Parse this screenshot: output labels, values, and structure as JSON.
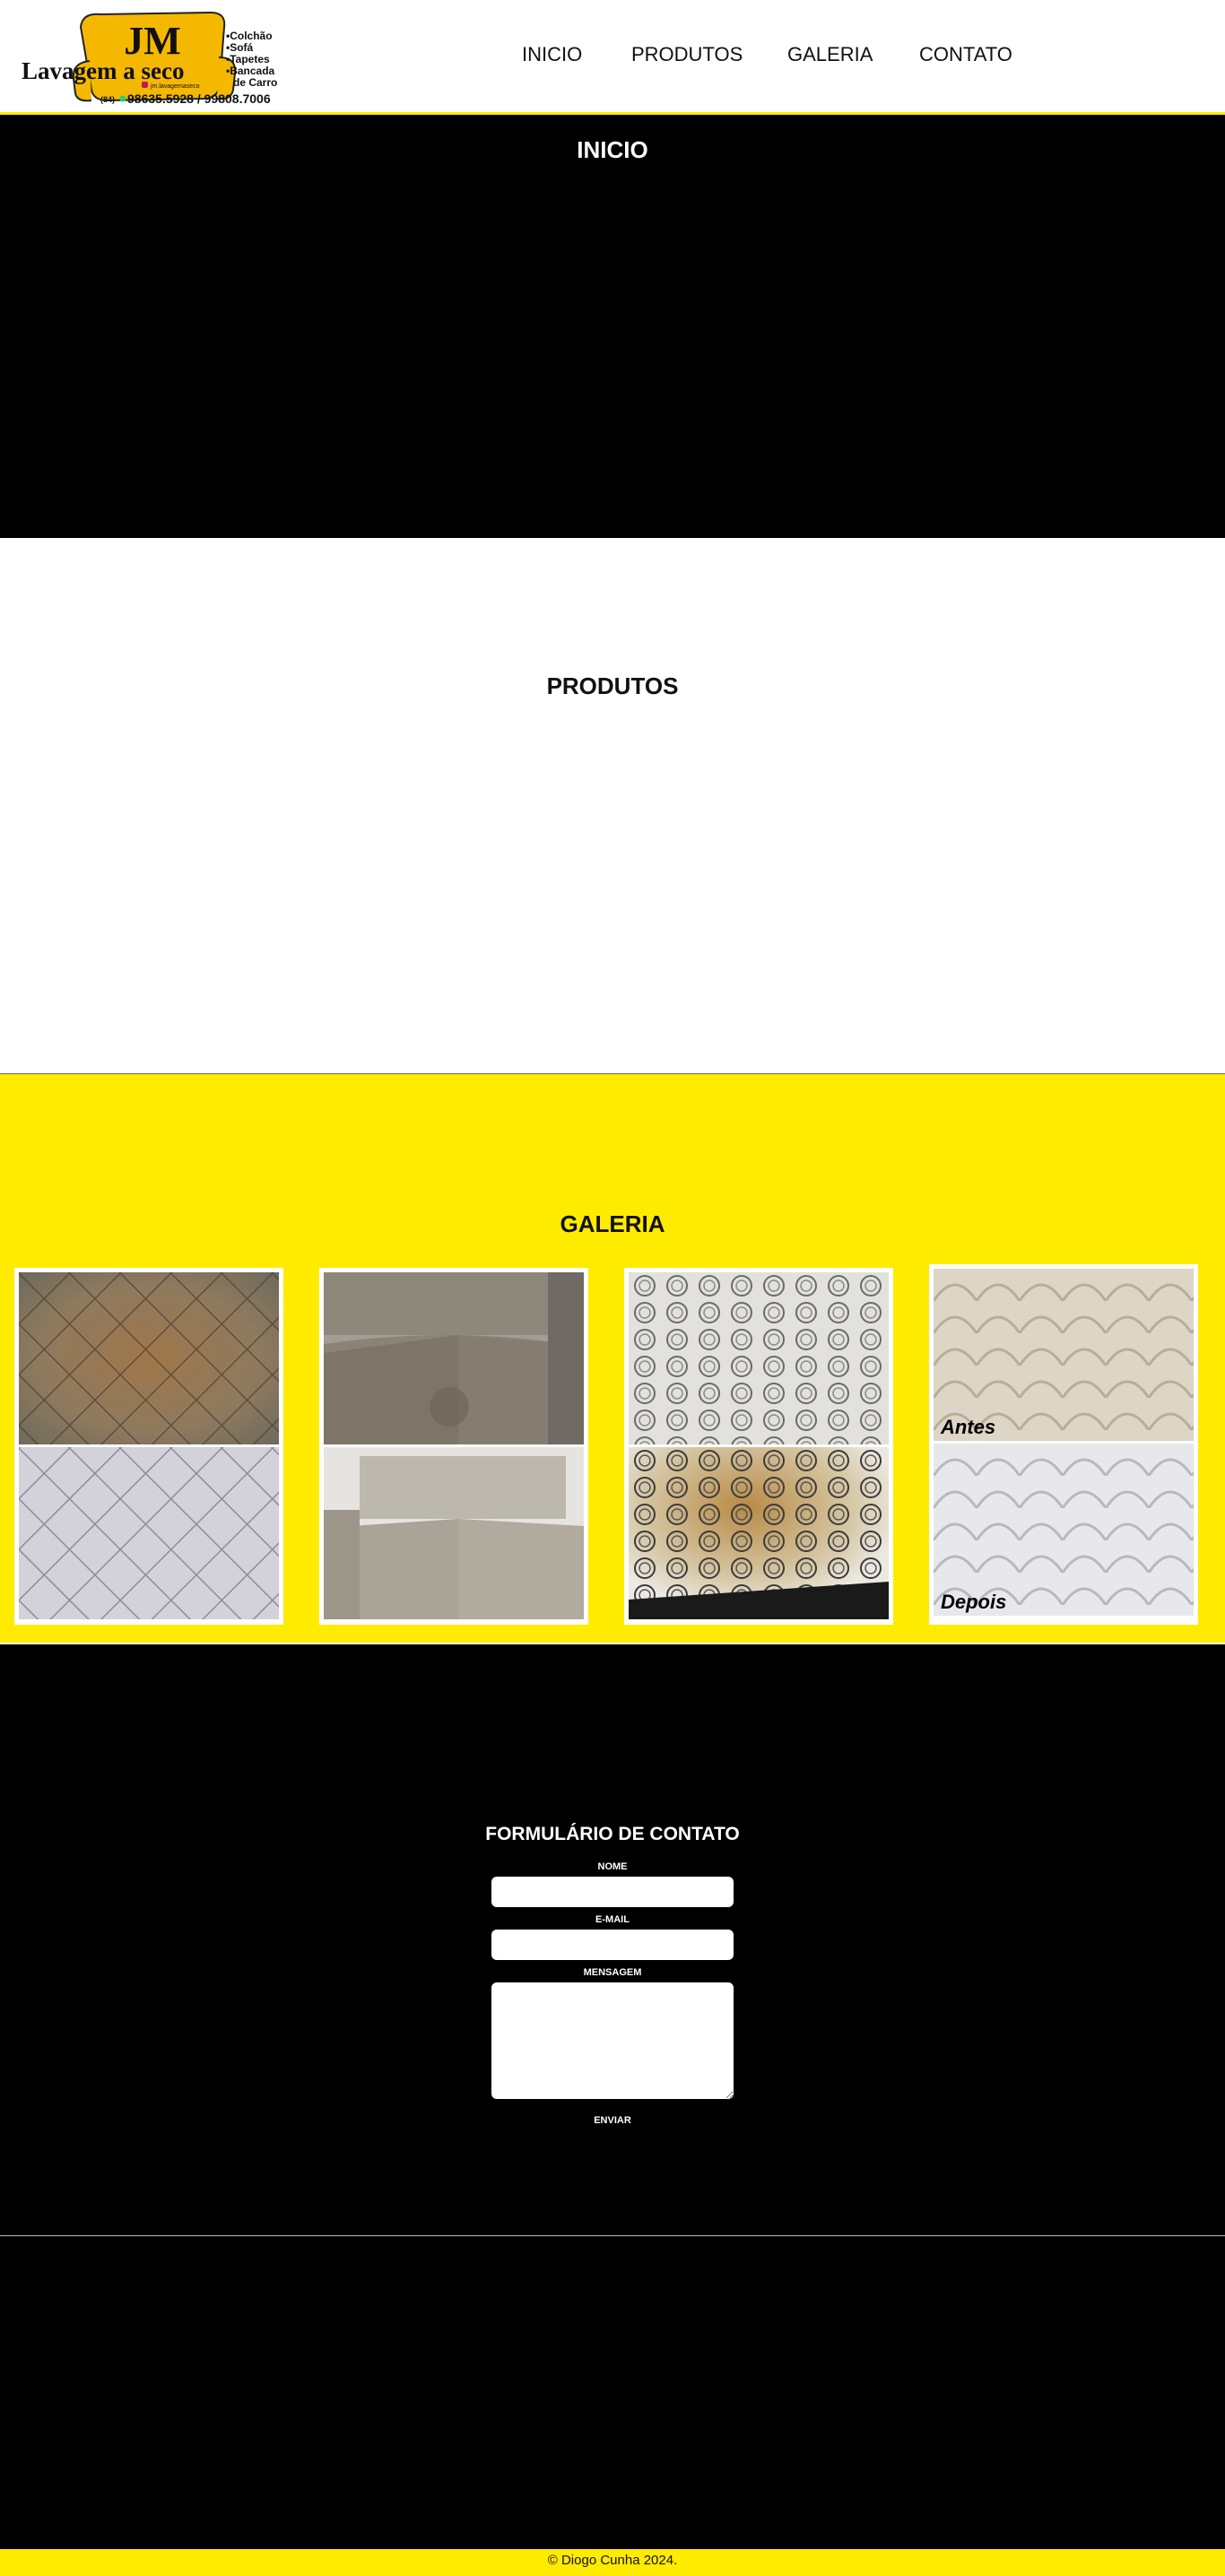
{
  "header": {
    "logo": {
      "mark": "JM",
      "name": "Lavagem a seco",
      "services": [
        "•Colchão",
        "•Sofá",
        "•Tapetes",
        "•Bancada",
        "de Carro"
      ],
      "area_code": "(84)",
      "phones": "98635.5928 / 99808.7006",
      "instagram": "jm.lavagemaseco"
    },
    "nav": [
      "INICIO",
      "PRODUTOS",
      "GALERIA",
      "CONTATO"
    ]
  },
  "inicio": {
    "title": "INICIO"
  },
  "produtos": {
    "title": "PRODUTOS"
  },
  "galeria": {
    "title": "GALERIA",
    "captions": {
      "before": "Antes",
      "after": "Depois"
    }
  },
  "contato": {
    "title": "FORMULÁRIO DE CONTATO",
    "name_label": "NOME",
    "email_label": "E-MAIL",
    "message_label": "MENSAGEM",
    "submit_label": "ENVIAR"
  },
  "footer": {
    "text": "© Diogo Cunha 2024."
  },
  "colors": {
    "accent": "#ffeb00",
    "dark": "#000000",
    "light": "#ffffff"
  }
}
